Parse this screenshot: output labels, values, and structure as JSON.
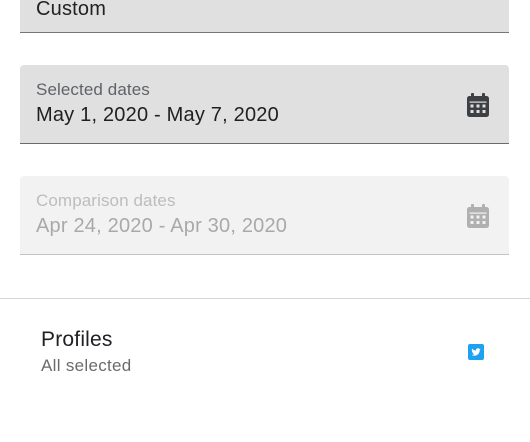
{
  "range_field": {
    "value": "Custom"
  },
  "selected_dates": {
    "label": "Selected dates",
    "value": "May 1, 2020 - May 7, 2020",
    "icon": "calendar-icon"
  },
  "comparison_dates": {
    "label": "Comparison dates",
    "value": "Apr 24, 2020 - Apr 30, 2020",
    "icon": "calendar-icon",
    "disabled": true
  },
  "profiles": {
    "title": "Profiles",
    "subtitle": "All selected",
    "icon": "twitter-icon",
    "icon_color": "#1da1f2"
  },
  "colors": {
    "field_bg": "#e0e0e0",
    "field_disabled_bg": "#f2f2f2",
    "icon_active": "#3c4043",
    "icon_disabled": "#b0b0b0"
  }
}
